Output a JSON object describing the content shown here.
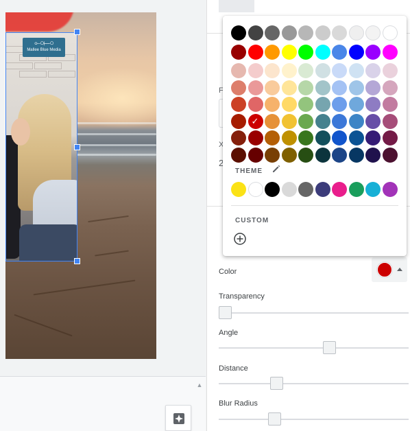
{
  "canvas": {
    "logo_text": "Mallee Blue Media",
    "logo_glyph": "⟜○⟝○"
  },
  "panel": {
    "color_label": "Color",
    "color_value": "#cc0000",
    "transparency_label": "Transparency",
    "transparency_value": 0.0,
    "angle_label": "Angle",
    "angle_value": 0.59,
    "distance_label": "Distance",
    "distance_value": 0.29,
    "blur_label": "Blur Radius",
    "blur_value": 0.28,
    "peek_f": "F",
    "peek_x": "X",
    "peek_2": "2"
  },
  "palette": {
    "theme_label": "THEME",
    "custom_label": "CUSTOM",
    "selected_row": 5,
    "selected_col": 1,
    "rows": [
      [
        "#000000",
        "#434343",
        "#666666",
        "#999999",
        "#b7b7b7",
        "#cccccc",
        "#d9d9d9",
        "#efefef",
        "#f3f3f3",
        "#ffffff"
      ],
      [
        "#980000",
        "#ff0000",
        "#ff9900",
        "#ffff00",
        "#00ff00",
        "#00ffff",
        "#4a86e8",
        "#0000ff",
        "#9900ff",
        "#ff00ff"
      ],
      [
        "#e6b8af",
        "#f4cccc",
        "#fce5cd",
        "#fff2cc",
        "#d9ead3",
        "#d0e0e3",
        "#c9daf8",
        "#cfe2f3",
        "#d9d2e9",
        "#ead1dc"
      ],
      [
        "#dd7e6b",
        "#ea9999",
        "#f9cb9c",
        "#ffe599",
        "#b6d7a8",
        "#a2c4c9",
        "#a4c2f4",
        "#9fc5e8",
        "#b4a7d6",
        "#d5a6bd"
      ],
      [
        "#cc4125",
        "#e06666",
        "#f6b26b",
        "#ffd966",
        "#93c47d",
        "#76a5af",
        "#6d9eeb",
        "#6fa8dc",
        "#8e7cc3",
        "#c27ba0"
      ],
      [
        "#a61c00",
        "#cc0000",
        "#e69138",
        "#f1c232",
        "#6aa84f",
        "#45818e",
        "#3c78d8",
        "#3d85c6",
        "#674ea7",
        "#a64d79"
      ],
      [
        "#85200c",
        "#990000",
        "#b45f06",
        "#bf9000",
        "#38761d",
        "#134f5c",
        "#1155cc",
        "#0b5394",
        "#351c75",
        "#741b47"
      ],
      [
        "#5b0f00",
        "#660000",
        "#783f04",
        "#7f6000",
        "#274e13",
        "#0c343d",
        "#1c4587",
        "#073763",
        "#20124d",
        "#4c1130"
      ]
    ],
    "theme_colors": [
      "#fbe216",
      "#ffffff",
      "#000000",
      "#d9d9d9",
      "#666666",
      "#3c3c7a",
      "#e91e8c",
      "#1a9e5c",
      "#17b0d6",
      "#a233b8"
    ]
  }
}
